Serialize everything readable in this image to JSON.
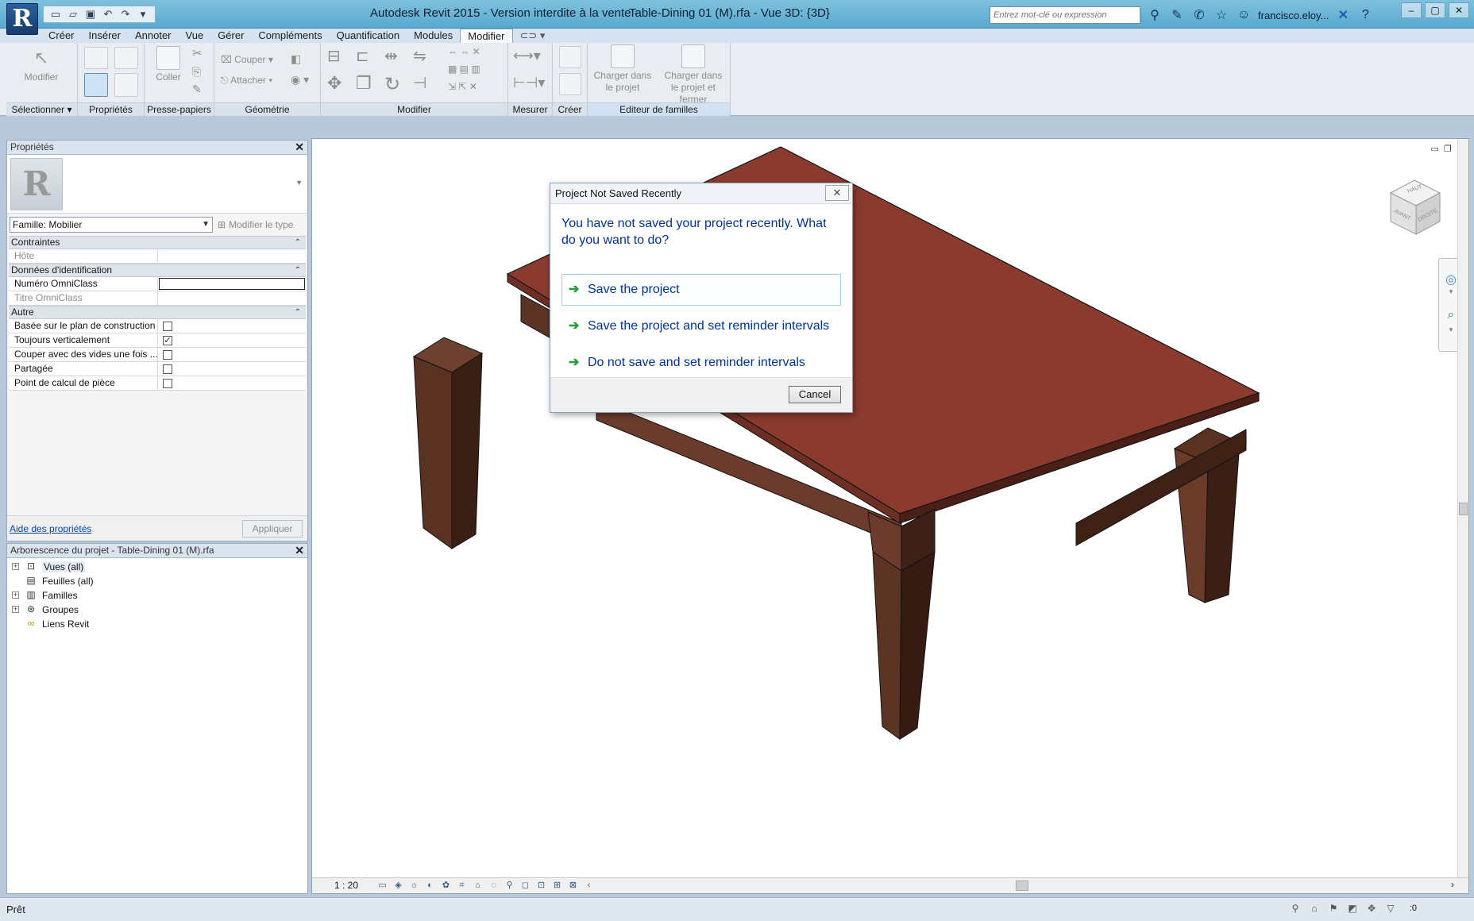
{
  "window": {
    "app_title": "Autodesk Revit 2015 - Version interdite à la vente -",
    "doc_title": "Table-Dining 01 (M).rfa - Vue 3D: {3D}",
    "search_placeholder": "Entrez mot-clé ou expression",
    "user": "francisco.eloy...",
    "app_button_letter": "R"
  },
  "ribbon_tabs": [
    "Créer",
    "Insérer",
    "Annoter",
    "Vue",
    "Gérer",
    "Compléments",
    "Quantification",
    "Modules",
    "Modifier"
  ],
  "ribbon_active_tab": "Modifier",
  "ribbon": {
    "modify_label": "Modifier",
    "paste_label": "Coller",
    "cut_label": "Couper",
    "join_label": "Attacher",
    "load_project_label_1": "Charger dans",
    "load_project_label_2": "le projet",
    "load_close_label_1": "Charger dans",
    "load_close_label_2": "le projet et fermer",
    "panels": {
      "select": "Sélectionner ▾",
      "properties": "Propriétés",
      "clipboard": "Presse-papiers",
      "geometry": "Géométrie",
      "modify": "Modifier",
      "measure": "Mesurer",
      "create": "Créer",
      "family_editor": "Editeur de familles"
    }
  },
  "properties": {
    "title": "Propriétés",
    "family_select": "Famille: Mobilier",
    "edit_type": "Modifier le type",
    "sections": {
      "constraints": "Contraintes",
      "identity": "Données d'identification",
      "other": "Autre"
    },
    "rows": {
      "host": "Hôte",
      "omniclass_number": "Numéro OmniClass",
      "omniclass_title": "Titre OmniClass",
      "work_plane_based": "Basée sur le plan de construction",
      "always_vertical": "Toujours verticalement",
      "cut_with_voids": "Couper avec des vides une fois ...",
      "shared": "Partagée",
      "room_calc_point": "Point de calcul de pièce"
    },
    "checks": {
      "work_plane_based": false,
      "always_vertical": true,
      "cut_with_voids": false,
      "shared": false,
      "room_calc_point": false
    },
    "help_link": "Aide des propriétés",
    "apply": "Appliquer"
  },
  "project_browser": {
    "title": "Arborescence du projet - Table-Dining 01 (M).rfa",
    "items": [
      {
        "label": "Vues (all)",
        "icon": "views-icon"
      },
      {
        "label": "Feuilles (all)",
        "icon": "sheets-icon"
      },
      {
        "label": "Familles",
        "icon": "families-icon"
      },
      {
        "label": "Groupes",
        "icon": "groups-icon"
      },
      {
        "label": "Liens Revit",
        "icon": "revit-links-icon"
      }
    ]
  },
  "viewcube": {
    "top": "HAUT",
    "front": "AVANT",
    "right": "DROITE"
  },
  "view_bar": {
    "scale": "1 : 20"
  },
  "dialog": {
    "title": "Project Not Saved Recently",
    "question": "You have not saved your project recently.  What do you want to do?",
    "options": [
      "Save the project",
      "Save the project and set reminder intervals",
      "Do not save and set reminder intervals"
    ],
    "cancel": "Cancel"
  },
  "status": {
    "text": "Prêt",
    "filter_count": ":0"
  },
  "colors": {
    "table_top": "#8b3a2e",
    "table_wood_light": "#6a3a2c",
    "table_wood_dark": "#3b1f17",
    "dialog_text": "#003399"
  }
}
